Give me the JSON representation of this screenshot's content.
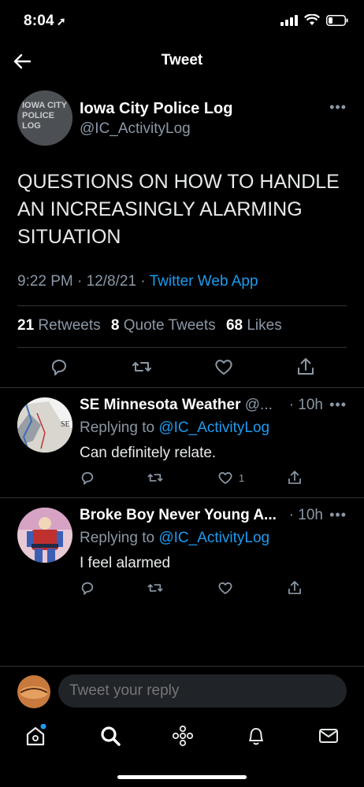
{
  "status_bar": {
    "time": "8:04",
    "location_icon": "location-arrow-icon"
  },
  "header": {
    "title": "Tweet"
  },
  "tweet": {
    "author_name": "Iowa City Police Log",
    "author_handle": "@IC_ActivityLog",
    "avatar_text": "IOWA CITY POLICE LOG",
    "text": "QUESTIONS ON HOW TO HANDLE AN INCREASINGLY ALARMING SITUATION",
    "timestamp": "9:22 PM · 12/8/21 · ",
    "source": "Twitter Web App",
    "retweets_count": "21",
    "retweets_label": "Retweets",
    "quotes_count": "8",
    "quotes_label": "Quote Tweets",
    "likes_count": "68",
    "likes_label": "Likes"
  },
  "replies": [
    {
      "name": "SE Minnesota Weather",
      "handle": " @...",
      "time": "· 10h",
      "replying_prefix": "Replying to ",
      "replying_to": "@IC_ActivityLog",
      "text": "Can definitely relate.",
      "like_count": "1"
    },
    {
      "name": "Broke Boy Never Young A...",
      "handle": "",
      "time": "· 10h",
      "replying_prefix": "Replying to ",
      "replying_to": "@IC_ActivityLog",
      "text": "I feel alarmed",
      "like_count": ""
    }
  ],
  "composer": {
    "placeholder": "Tweet your reply"
  },
  "tabs": [
    "home-icon",
    "search-icon",
    "spaces-icon",
    "notifications-icon",
    "messages-icon"
  ],
  "colors": {
    "accent": "#1d9bf0",
    "muted": "#8b98a5",
    "background": "#000000"
  }
}
